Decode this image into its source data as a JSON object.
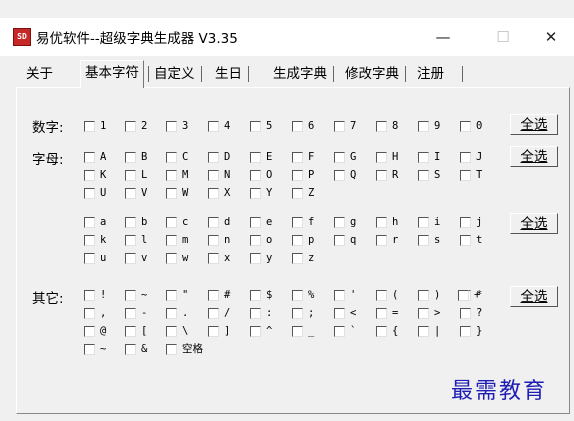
{
  "window": {
    "title": "易优软件--超级字典生成器 V3.35",
    "icon_text": "SD",
    "minimize": "—",
    "maximize": "☐",
    "close": "✕"
  },
  "tabs": [
    "关于",
    "基本字符",
    "自定义",
    "生日",
    "生成字典",
    "修改字典",
    "注册"
  ],
  "active_tab": "基本字符",
  "select_all_label": "全选",
  "rows": {
    "digits_label": "数字:",
    "letters_label": "字母:",
    "others_label": "其它:"
  },
  "digits": [
    "1",
    "2",
    "3",
    "4",
    "5",
    "6",
    "7",
    "8",
    "9",
    "0"
  ],
  "upper": [
    [
      "A",
      "B",
      "C",
      "D",
      "E",
      "F",
      "G",
      "H",
      "I",
      "J"
    ],
    [
      "K",
      "L",
      "M",
      "N",
      "O",
      "P",
      "Q",
      "R",
      "S",
      "T"
    ],
    [
      "U",
      "V",
      "W",
      "X",
      "Y",
      "Z"
    ]
  ],
  "lower": [
    [
      "a",
      "b",
      "c",
      "d",
      "e",
      "f",
      "g",
      "h",
      "i",
      "j"
    ],
    [
      "k",
      "l",
      "m",
      "n",
      "o",
      "p",
      "q",
      "r",
      "s",
      "t"
    ],
    [
      "u",
      "v",
      "w",
      "x",
      "y",
      "z"
    ]
  ],
  "others": [
    [
      "!",
      "~",
      "\"",
      "#",
      "$",
      "%",
      "'",
      "(",
      ")",
      "*",
      "+"
    ],
    [
      ",",
      "-",
      ".",
      "/",
      ":",
      ";",
      "<",
      "=",
      ">",
      "?"
    ],
    [
      "@",
      "[",
      "\\",
      "]",
      "^",
      "_",
      "`",
      "{",
      "|",
      "}"
    ],
    [
      "~",
      "&",
      "空格"
    ]
  ],
  "watermark": "最需教育"
}
